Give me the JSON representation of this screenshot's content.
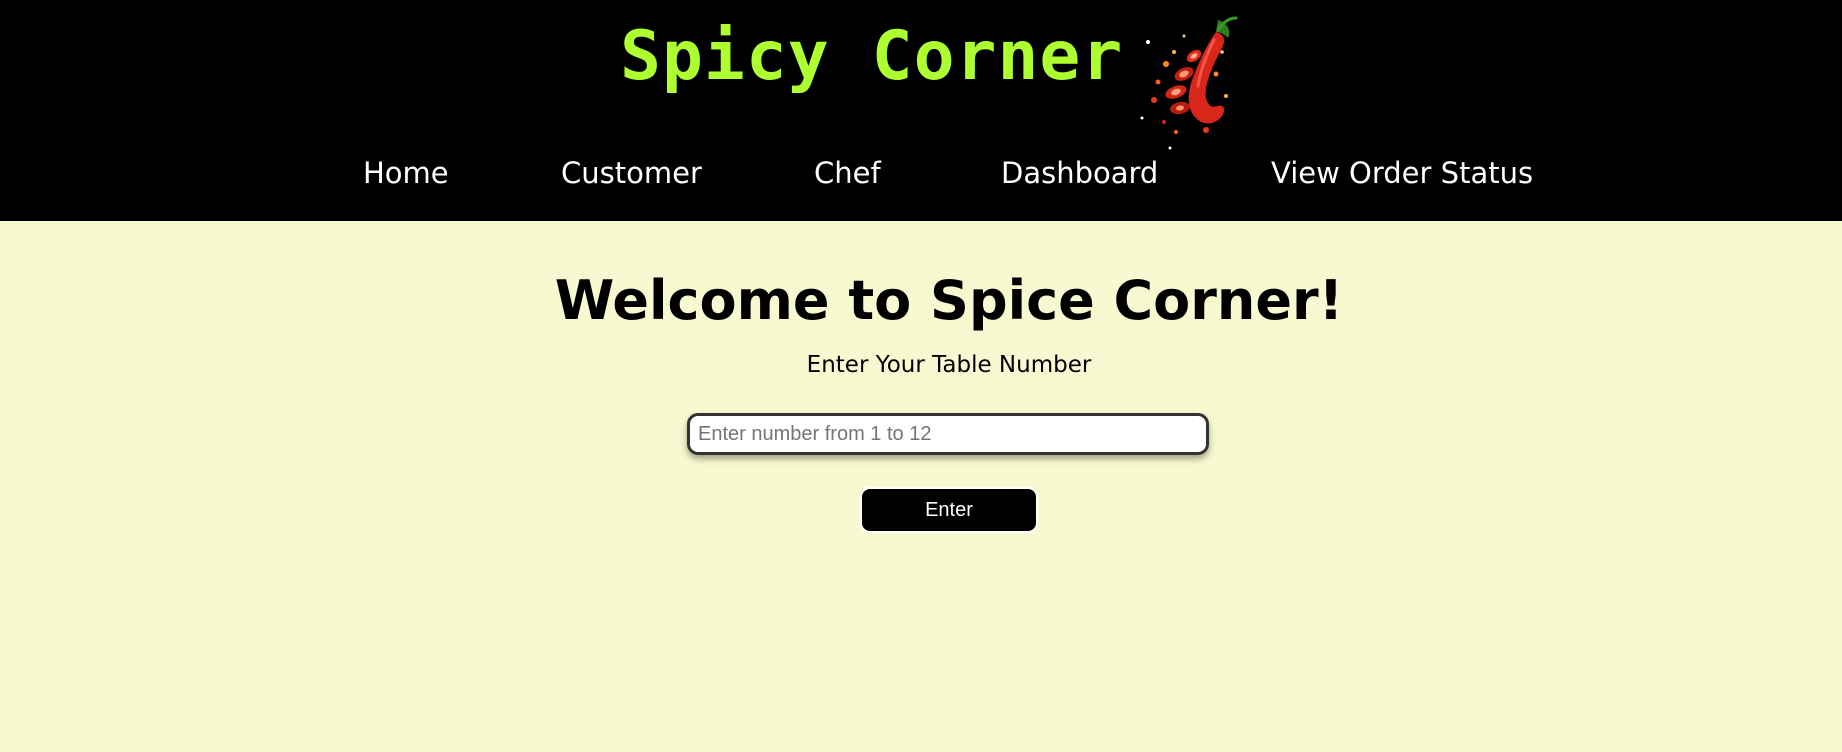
{
  "header": {
    "brand_title": "Spicy Corner",
    "logo_icon": "chili-pepper-icon",
    "brand_color": "#adff2f",
    "background_color": "#000000"
  },
  "nav": {
    "items": [
      {
        "label": "Home"
      },
      {
        "label": "Customer"
      },
      {
        "label": "Chef"
      },
      {
        "label": "Dashboard"
      },
      {
        "label": "View Order Status"
      }
    ]
  },
  "main": {
    "welcome_title": "Welcome to Spice Corner!",
    "table_label": "Enter Your Table Number",
    "table_input": {
      "value": "",
      "placeholder": "Enter number from 1 to 12"
    },
    "enter_button_label": "Enter",
    "background_color": "#f9f9d1"
  }
}
